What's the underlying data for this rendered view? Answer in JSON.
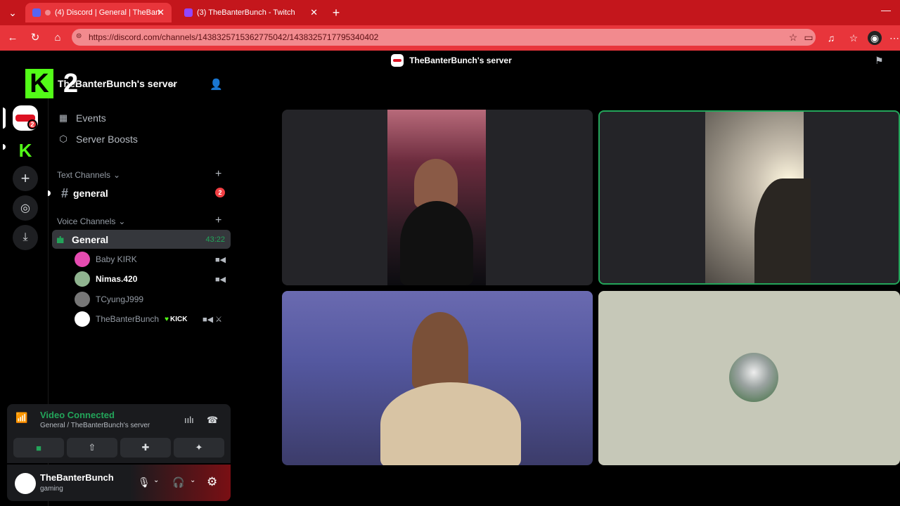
{
  "browser": {
    "tabs": [
      {
        "label": "(4) Discord | General | TheBan",
        "active": true
      },
      {
        "label": "(3) TheBanterBunch - Twitch",
        "active": false
      }
    ],
    "url": "https://discord.com/channels/1438325715362775042/1438325717795340402"
  },
  "topbar": {
    "title": "TheBanterBunch's server"
  },
  "overlay": {
    "kick_letter": "K",
    "kick_number": "2"
  },
  "guild_rail": {
    "server_badge": "2"
  },
  "sidebar": {
    "server_name": "TheBanterBunch's server",
    "menu": [
      {
        "label": "Events",
        "icon": "calendar-icon"
      },
      {
        "label": "Server Boosts",
        "icon": "boost-icon"
      }
    ],
    "text_category": "Text Channels",
    "text_channels": [
      {
        "name": "general",
        "badge": "2"
      }
    ],
    "voice_category": "Voice Channels",
    "voice_channel": {
      "name": "General",
      "time": "43:22"
    },
    "voice_users": [
      {
        "name": "Baby KIRK",
        "camera": true
      },
      {
        "name": "Nimas.420",
        "camera": true
      },
      {
        "name": "TCyungJ999",
        "camera": false
      },
      {
        "name": "TheBanterBunch",
        "tag": "KICK",
        "camera": true
      }
    ]
  },
  "voice_panel": {
    "status": "Video Connected",
    "channel": "General / TheBanterBunch's server"
  },
  "user_panel": {
    "name": "TheBanterBunch",
    "status": "gaming"
  },
  "colors": {
    "accent_green": "#23a55a",
    "browser_red": "#c4161c",
    "kick_green": "#53fc18",
    "badge_red": "#f23f43"
  }
}
